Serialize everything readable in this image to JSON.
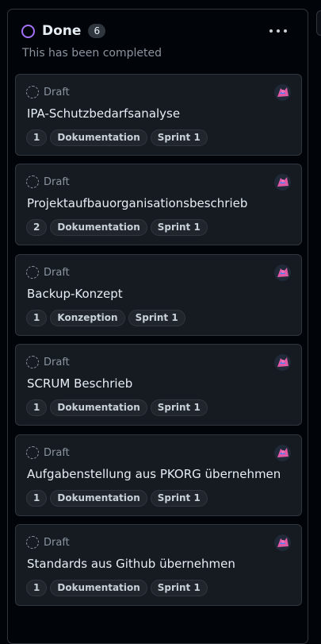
{
  "column": {
    "title": "Done",
    "count": "6",
    "description": "This has been completed",
    "status_color": "#a371f7"
  },
  "cards": [
    {
      "status": "Draft",
      "title": "IPA-Schutzbedarfsanalyse",
      "labels": [
        "1",
        "Dokumentation",
        "Sprint 1"
      ]
    },
    {
      "status": "Draft",
      "title": "Projektaufbauorganisationsbeschrieb",
      "labels": [
        "2",
        "Dokumentation",
        "Sprint 1"
      ]
    },
    {
      "status": "Draft",
      "title": "Backup-Konzept",
      "labels": [
        "1",
        "Konzeption",
        "Sprint 1"
      ]
    },
    {
      "status": "Draft",
      "title": "SCRUM Beschrieb",
      "labels": [
        "1",
        "Dokumentation",
        "Sprint 1"
      ]
    },
    {
      "status": "Draft",
      "title": "Aufgabenstellung aus PKORG übernehmen",
      "labels": [
        "1",
        "Dokumentation",
        "Sprint 1"
      ]
    },
    {
      "status": "Draft",
      "title": "Standards aus Github übernehmen",
      "labels": [
        "1",
        "Dokumentation",
        "Sprint 1"
      ]
    }
  ]
}
